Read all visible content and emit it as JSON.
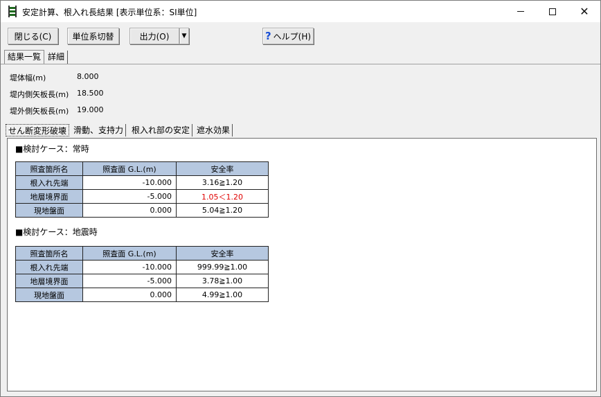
{
  "window": {
    "title": "安定計算、根入れ長結果 [表示単位系：SI単位]",
    "controls": {
      "minimize": "—",
      "maximize": "☐",
      "close": "✕"
    }
  },
  "toolbar": {
    "close_label": "閉じる(C)",
    "unit_label": "単位系切替",
    "output_label": "出力(O)",
    "output_dropdown": "▼",
    "help_label": "ヘルプ(H)",
    "help_icon": "?"
  },
  "tabs": [
    "結果一覧",
    "詳細"
  ],
  "info": [
    {
      "label": "堤体幅(m)",
      "value": "8.000"
    },
    {
      "label": "堤内側矢板長(m)",
      "value": "18.500"
    },
    {
      "label": "堤外側矢板長(m)",
      "value": "19.000"
    }
  ],
  "subtabs": [
    "せん断変形破壊",
    "滑動、支持力",
    "根入れ部の安定",
    "遮水効果"
  ],
  "cases": [
    {
      "title": "■検討ケース：常時",
      "headers": [
        "照査箇所名",
        "照査面 G.L.(m)",
        "安全率"
      ],
      "rows": [
        {
          "name": "根入れ先端",
          "gl": "-10.000",
          "rate": "3.16≧1.20",
          "ng": false
        },
        {
          "name": "地層境界面",
          "gl": "-5.000",
          "rate": "1.05＜1.20",
          "ng": true
        },
        {
          "name": "現地盤面",
          "gl": "0.000",
          "rate": "5.04≧1.20",
          "ng": false
        }
      ]
    },
    {
      "title": "■検討ケース：地震時",
      "headers": [
        "照査箇所名",
        "照査面 G.L.(m)",
        "安全率"
      ],
      "rows": [
        {
          "name": "根入れ先端",
          "gl": "-10.000",
          "rate": "999.99≧1.00",
          "ng": false
        },
        {
          "name": "地層境界面",
          "gl": "-5.000",
          "rate": "3.78≧1.00",
          "ng": false
        },
        {
          "name": "現地盤面",
          "gl": "0.000",
          "rate": "4.99≧1.00",
          "ng": false
        }
      ]
    }
  ],
  "colors": {
    "header_bg": "#b6c8e0",
    "ng_text": "#e00000",
    "help_icon": "#1a4fd6"
  }
}
